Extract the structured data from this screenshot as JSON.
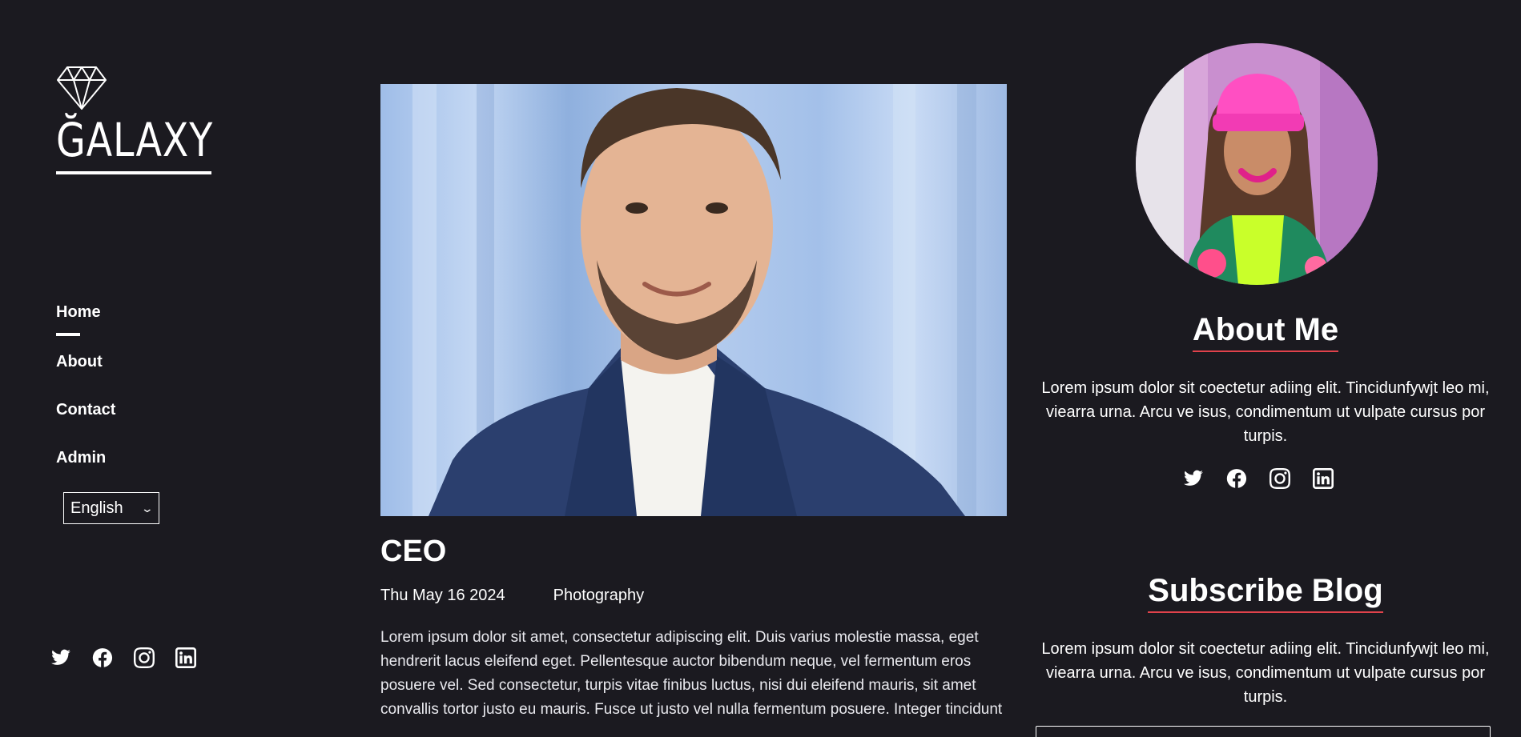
{
  "brand": {
    "name": "ĞALAXY"
  },
  "nav": {
    "items": [
      {
        "label": "Home",
        "active": true
      },
      {
        "label": "About",
        "active": false
      },
      {
        "label": "Contact",
        "active": false
      },
      {
        "label": "Admin",
        "active": false
      }
    ]
  },
  "language": {
    "selected": "English"
  },
  "social_icons": [
    "twitter-icon",
    "facebook-icon",
    "instagram-icon",
    "linkedin-icon"
  ],
  "post": {
    "title": "CEO",
    "date": "Thu May 16 2024",
    "category": "Photography",
    "body": "Lorem ipsum dolor sit amet, consectetur adipiscing elit. Duis varius molestie massa, eget hendrerit lacus eleifend eget. Pellentesque auctor bibendum neque, vel fermentum eros posuere vel. Sed consectetur, turpis vitae finibus luctus, nisi dui eleifend mauris, sit amet convallis tortor justo eu mauris. Fusce ut justo vel nulla fermentum posuere. Integer tincidunt"
  },
  "about": {
    "title": "About Me",
    "text": "Lorem ipsum dolor sit coectetur adiing elit. Tincidunfywjt leo mi, viearra urna. Arcu ve isus, condimentum ut vulpate cursus por turpis."
  },
  "subscribe": {
    "title": "Subscribe Blog",
    "text": "Lorem ipsum dolor sit coectetur adiing elit. Tincidunfywjt leo mi, viearra urna. Arcu ve isus, condimentum ut vulpate cursus por turpis."
  },
  "colors": {
    "background": "#1b1a20",
    "accent": "#e0424b",
    "text": "#ffffff"
  }
}
